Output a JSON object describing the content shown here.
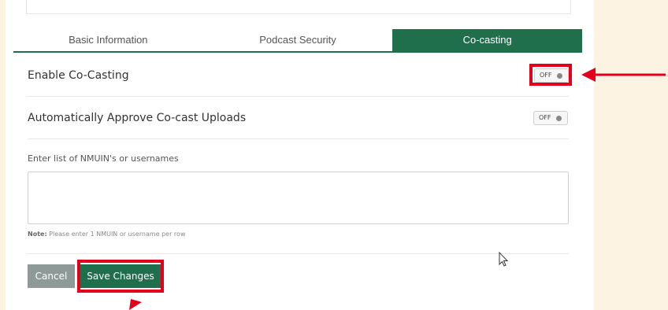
{
  "tabs": [
    {
      "label": "Basic Information",
      "active": false
    },
    {
      "label": "Podcast Security",
      "active": false
    },
    {
      "label": "Co-casting",
      "active": true
    }
  ],
  "settings": {
    "enable_cocasting": {
      "label": "Enable Co-Casting",
      "toggle": "OFF"
    },
    "auto_approve": {
      "label": "Automatically Approve Co-cast Uploads",
      "toggle": "OFF"
    }
  },
  "users_field": {
    "label": "Enter list of NMUIN's or usernames",
    "value": "",
    "note_bold": "Note:",
    "note_text": " Please enter 1 NMUIN or username per row"
  },
  "buttons": {
    "cancel": "Cancel",
    "save": "Save Changes"
  },
  "colors": {
    "brand": "#1f6e4c",
    "highlight": "#e3001b",
    "background": "#fdf3e3"
  }
}
